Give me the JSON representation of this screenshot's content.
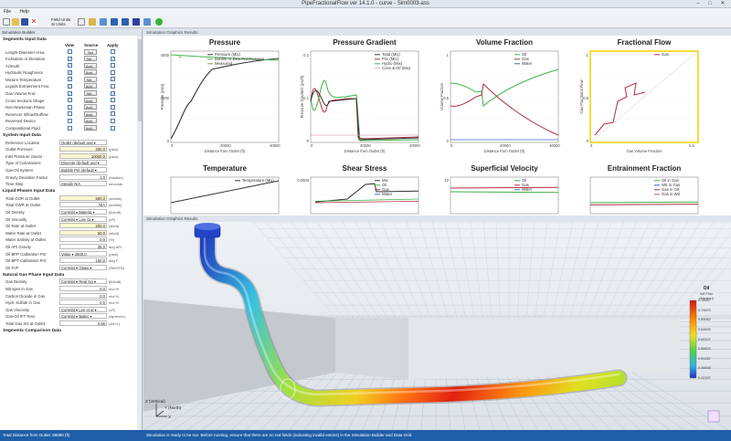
{
  "window": {
    "title": "PipeFractionalFlow ver 14.1.0 - curve - Sim0003-ass",
    "min": "–",
    "max": "□",
    "close": "✕"
  },
  "menu": [
    "File",
    "Help"
  ],
  "toolbar": {
    "units_line1": "Field Units",
    "units_line2": "SI Units"
  },
  "left_panel": {
    "header": "Simulation Builder",
    "segments_title": "Segments Input Data",
    "col_view": "View",
    "col_source": "Source",
    "col_apply": "Apply",
    "segments": [
      {
        "label": "Length-Diameter-Area",
        "view": false,
        "source": "Set",
        "apply": false
      },
      {
        "label": "Inclination or Elevation",
        "view": true,
        "source": "Set...",
        "apply": true
      },
      {
        "label": "Azimuth",
        "view": true,
        "source": "Add...",
        "apply": false
      },
      {
        "label": "Hydraulic Roughness",
        "view": true,
        "source": "Add...",
        "apply": false
      },
      {
        "label": "Mixture Temperature",
        "view": true,
        "source": "Set...",
        "apply": true
      },
      {
        "label": "Liquids Entrainment Frac",
        "view": true,
        "source": "Add...",
        "apply": false
      },
      {
        "label": "Gas Volume Frac",
        "view": true,
        "source": "Set...",
        "apply": true
      },
      {
        "label": "Cross Sections Shape",
        "view": false,
        "source": "Add...",
        "apply": false
      },
      {
        "label": "Non-Newtonian Phase",
        "view": false,
        "source": "Add...",
        "apply": false
      },
      {
        "label": "Reservoir Inflow/Outflow",
        "view": false,
        "source": "Add...",
        "apply": false
      },
      {
        "label": "Reversed Device",
        "view": false,
        "source": "Add...",
        "apply": false
      },
      {
        "label": "Compositional Fluid",
        "view": false,
        "source": "Add...",
        "apply": false
      }
    ],
    "system_title": "System Input Data",
    "system": [
      {
        "label": "Reference Location",
        "value": "Outlet (default and ▾",
        "unit": "",
        "num": false,
        "yel": false
      },
      {
        "label": "Outlet Pressure",
        "value": "200.0",
        "unit": "(psia)",
        "num": true,
        "yel": true
      },
      {
        "label": "Inlet Pressure Guess",
        "value": "10000.0",
        "unit": "(psia)",
        "num": true,
        "yel": true
      },
      {
        "label": "Type of Calculations",
        "value": "Discrete (default and ▾",
        "unit": "",
        "num": false,
        "yel": false
      },
      {
        "label": "Gas-Oil System",
        "value": "Bubble Pnt (default ▾",
        "unit": "",
        "num": false,
        "yel": false
      },
      {
        "label": "Gravity Deviation Factor",
        "value": "1.0",
        "unit": "(fraction)",
        "num": true,
        "yel": false
      },
      {
        "label": "Time Step",
        "value": "Steady    N/A",
        "unit": "seconds",
        "num": false,
        "yel": false
      }
    ],
    "liquid_title": "Liquid Phases Input Data",
    "liquid": [
      {
        "label": "Total GOR at Outlet",
        "value": "500.0",
        "unit": "(scf/stb)",
        "num": true,
        "yel": true
      },
      {
        "label": "Total GWR at Outlet",
        "value": "N/A",
        "unit": "(scf/stb)",
        "num": true,
        "yel": false
      },
      {
        "label": "Oil Density",
        "value": "Correlat ▾  Materia ▾",
        "unit": "(lb/cuft)",
        "num": false,
        "yel": false
      },
      {
        "label": "Oil Viscosity",
        "value": "Correlat ▾  Live Oi ▾",
        "unit": "(cP)",
        "num": false,
        "yel": false
      },
      {
        "label": "Oil Rate at Outlet",
        "value": "200.0",
        "unit": "(stb/d)",
        "num": true,
        "yel": true
      },
      {
        "label": "Water Rate at Outlet",
        "value": "50.0",
        "unit": "(stb/d)",
        "num": true,
        "yel": true
      },
      {
        "label": "Water Salinity at Outlet",
        "value": "0.0",
        "unit": "(%)",
        "num": true,
        "yel": false
      },
      {
        "label": "Oil API Gravity",
        "value": "35.0",
        "unit": "deg API",
        "num": true,
        "yel": false
      },
      {
        "label": "Oil BPP Calibration Pnt",
        "value": "Value ▾       4500.0",
        "unit": "(psia)",
        "num": false,
        "yel": false
      },
      {
        "label": "Oil BPT Calibration Pnt",
        "value": "150.0",
        "unit": "deg F",
        "num": true,
        "yel": false
      },
      {
        "label": "Oil FVF",
        "value": "Correlat ▾  Glaso ▾",
        "unit": "(RB/STB)",
        "num": false,
        "yel": false
      }
    ],
    "gas_title": "Natural Gas Phase Input Data",
    "gas": [
      {
        "label": "Gas Density",
        "value": "Correlat ▾  Real Ga ▾",
        "unit": "(lb/cuft)",
        "num": false,
        "yel": false
      },
      {
        "label": "Nitrogen in Gas",
        "value": "0.0",
        "unit": "mol %",
        "num": true,
        "yel": false
      },
      {
        "label": "Carbon Dioxide in Gas",
        "value": "0.0",
        "unit": "mol %",
        "num": true,
        "yel": false
      },
      {
        "label": "Hydr. Sulfide in Gas",
        "value": "0.0",
        "unit": "mol %",
        "num": true,
        "yel": false
      },
      {
        "label": "Gas Viscosity",
        "value": "Correlat ▾  Lee et al ▾",
        "unit": "(cP)",
        "num": false,
        "yel": false
      },
      {
        "label": "Gas-Oil IFT Tens",
        "value": "Correlat ▾  Baker ▾",
        "unit": "(dyne/cm)",
        "num": false,
        "yel": false
      },
      {
        "label": "Total Gas SG at Outlet",
        "value": "0.65",
        "unit": "(Air=1)",
        "num": true,
        "yel": false
      }
    ],
    "comparison_title": "Segments Comparison Data"
  },
  "graphics": {
    "header": "Simulation Graphics Results",
    "charts": [
      {
        "title": "Pressure",
        "xlabel": "Distance from Outlet (ft)",
        "ylabel": "Pressure (psia)",
        "xticks": [
          "0",
          "20000",
          "40000"
        ],
        "yticks": [
          "0",
          "2000",
          "4000"
        ],
        "legend": [
          {
            "name": "Pressure (Mix)",
            "color": "#333333"
          },
          {
            "name": "Bubble or Dew Pnt Pressure",
            "color": "#4caf50"
          },
          {
            "name": "Measured",
            "color": "#8d9e3c"
          }
        ]
      },
      {
        "title": "Pressure Gradient",
        "xlabel": "Distance from Outlet (ft)",
        "ylabel": "Pressure Gradient (psi/ft)",
        "xticks": [
          "0",
          "20000",
          "40000"
        ],
        "yticks": [
          "0",
          "0.1",
          "0.2"
        ],
        "legend": [
          {
            "name": "Total (Mix)",
            "color": "#333333"
          },
          {
            "name": "Fric (Mix)",
            "color": "#b03040"
          },
          {
            "name": "Hydro (Mix)",
            "color": "#3cb043"
          },
          {
            "name": "Conv & Dif (Mix)",
            "color": "#e0a0c0"
          }
        ]
      },
      {
        "title": "Volume Fraction",
        "xlabel": "Distance from Outlet (ft)",
        "ylabel": "Volume Fraction",
        "xticks": [
          "0",
          "20000",
          "40000"
        ],
        "yticks": [
          "0",
          "0.5",
          "1"
        ],
        "legend": [
          {
            "name": "Oil",
            "color": "#3cb043"
          },
          {
            "name": "Gas",
            "color": "#b03040"
          },
          {
            "name": "Water",
            "color": "#3366cc"
          }
        ]
      },
      {
        "title": "Fractional Flow",
        "xlabel": "Gas Volume Fraction",
        "ylabel": "Gas Fractional Flow",
        "xticks": [
          "0",
          "0.5"
        ],
        "yticks": [
          "0",
          "0.5",
          "1"
        ],
        "legend": [
          {
            "name": "Gas",
            "color": "#b03040"
          }
        ]
      },
      {
        "title": "Temperature",
        "xlabel": "",
        "ylabel": "",
        "xticks": [],
        "yticks": [],
        "legend": [
          {
            "name": "Temperature (Mix)",
            "color": "#333333"
          }
        ]
      },
      {
        "title": "Shear Stress",
        "xlabel": "",
        "ylabel": "",
        "xticks": [],
        "yticks": [
          "0.0003"
        ],
        "legend": [
          {
            "name": "Mix",
            "color": "#333333"
          },
          {
            "name": "Oil",
            "color": "#3cb043"
          },
          {
            "name": "Gas",
            "color": "#b03040"
          },
          {
            "name": "Water",
            "color": "#3366cc"
          }
        ]
      },
      {
        "title": "Superficial Velocity",
        "xlabel": "",
        "ylabel": "",
        "xticks": [],
        "yticks": [
          "10"
        ],
        "legend": [
          {
            "name": "Oil",
            "color": "#3cb043"
          },
          {
            "name": "Gas",
            "color": "#b03040"
          },
          {
            "name": "Water",
            "color": "#3366cc"
          }
        ]
      },
      {
        "title": "Entrainment Fraction",
        "xlabel": "",
        "ylabel": "",
        "xticks": [],
        "yticks": [],
        "legend": [
          {
            "name": "Oil in Gas",
            "color": "#3cb043"
          },
          {
            "name": "Wtr in Gas",
            "color": "#3366cc"
          },
          {
            "name": "Gas in Oil",
            "color": "#b03040"
          },
          {
            "name": "Gas in Wtr",
            "color": "#c050a0"
          }
        ]
      }
    ]
  },
  "view3d": {
    "header": "Simulation Graphics Results",
    "legend_title": "Oil",
    "legend_sub1": "Vol Frac",
    "legend_sub2": "(fraction)",
    "legend_ticks": [
      "0.78057",
      "0.73570",
      "0.69082",
      "0.64595",
      "0.60107",
      "0.55620",
      "0.51132",
      "0.46645",
      "0.42157"
    ],
    "axis_z": "Z (Vertical)",
    "axis_y": "Y (North)",
    "axis_x": "X"
  },
  "status": {
    "left": "Total Distance from Outlet: 89899 (ft)",
    "right": "Simulation is ready to be run. Before running, ensure that there are no red fields (indicating invalid entries) in the Simulation Builder and Data Grid."
  }
}
